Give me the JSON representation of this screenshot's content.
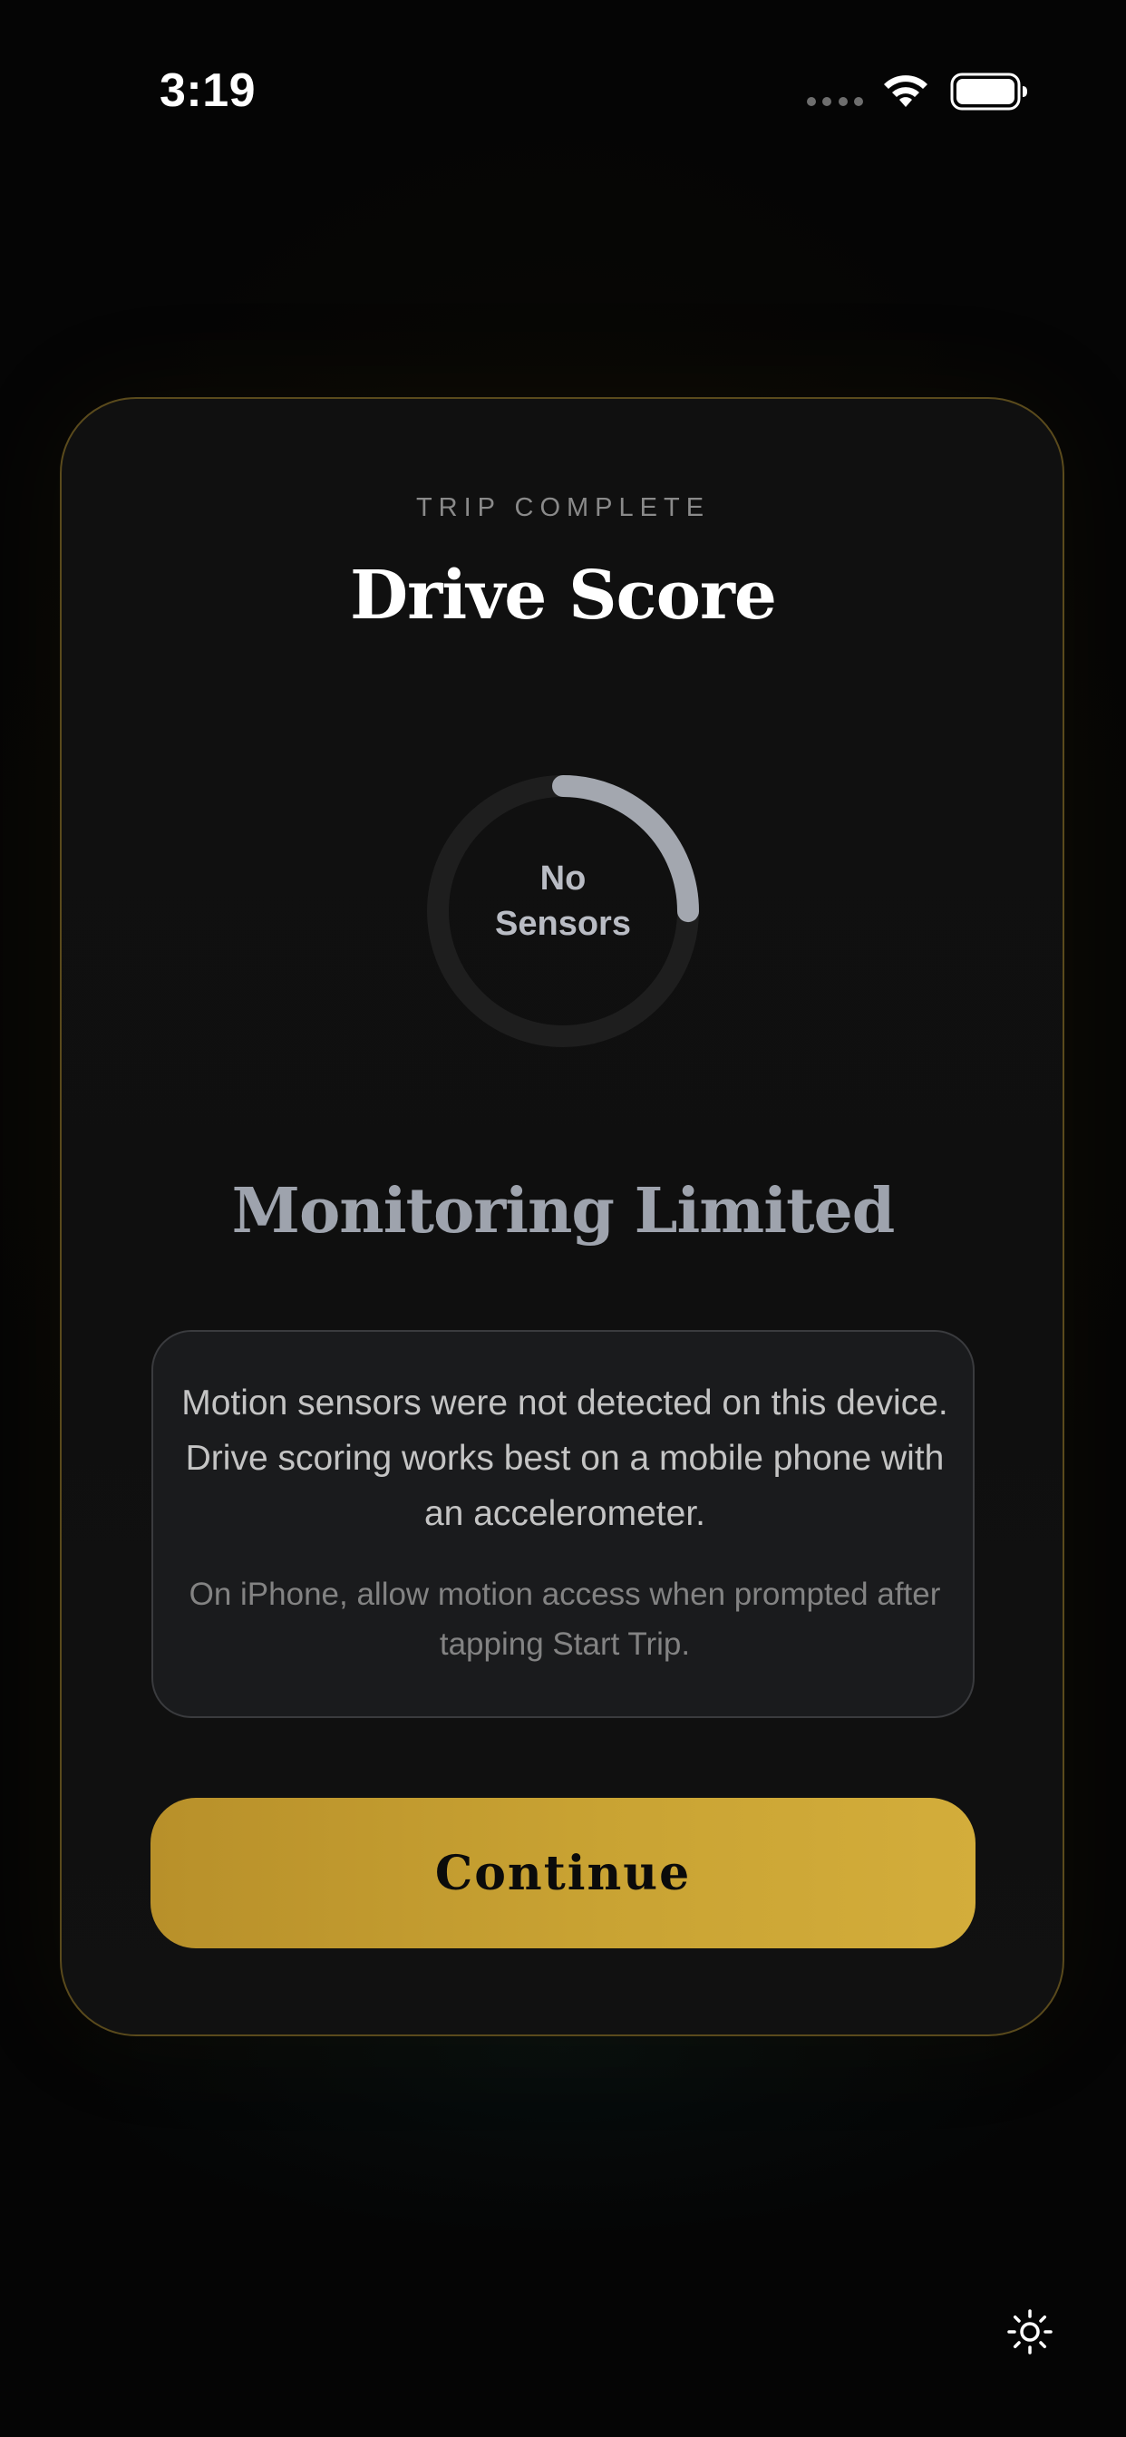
{
  "status_bar": {
    "time": "3:19",
    "icons": [
      "signal-dots-icon",
      "wifi-icon",
      "battery-icon"
    ]
  },
  "card": {
    "eyebrow": "TRIP COMPLETE",
    "title": "Drive Score",
    "gauge": {
      "label_line1": "No",
      "label_line2": "Sensors",
      "progress_fraction": 0.25,
      "track_color": "#1e1e1e",
      "progress_color": "#a3a7af"
    },
    "status_heading": "Monitoring Limited",
    "info": {
      "primary": "Motion sensors were not detected on this device. Drive scoring works best on a mobile phone with an accelerometer.",
      "secondary": "On iPhone, allow motion access when prompted after tapping Start Trip."
    },
    "continue_label": "Continue"
  },
  "colors": {
    "accent_gold": "#c9a333",
    "card_border": "#5a4a1c",
    "background": "#050505"
  },
  "theme_toggle_icon": "sun-icon"
}
